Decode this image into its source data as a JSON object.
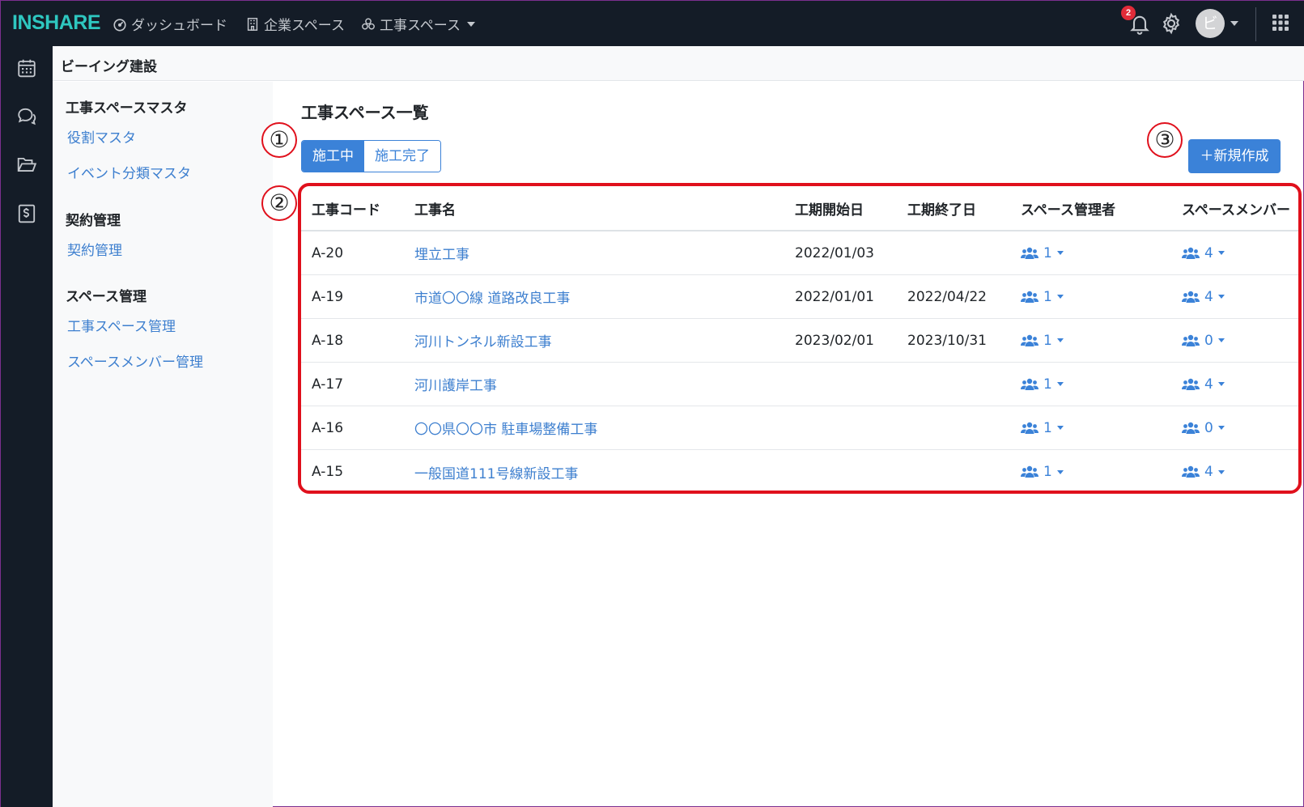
{
  "topbar": {
    "logo": "INSHARE",
    "nav": [
      {
        "label": "ダッシュボード",
        "icon": "dashboard-gauge-icon"
      },
      {
        "label": "企業スペース",
        "icon": "building-icon"
      },
      {
        "label": "工事スペース",
        "icon": "cubes-icon"
      }
    ],
    "notification_count": "2",
    "avatar_initial": "ビ"
  },
  "rail": {
    "icons": [
      "calendar-icon",
      "chat-icon",
      "folder-icon",
      "contract-icon"
    ]
  },
  "breadcrumb": {
    "company": "ビーイング建設"
  },
  "sidenav": {
    "sections": [
      {
        "title": "工事スペースマスタ",
        "links": [
          "役割マスタ",
          "イベント分類マスタ"
        ]
      },
      {
        "title": "契約管理",
        "links": [
          "契約管理"
        ]
      },
      {
        "title": "スペース管理",
        "links": [
          "工事スペース管理",
          "スペースメンバー管理"
        ]
      }
    ]
  },
  "main": {
    "title": "工事スペース一覧",
    "filters": [
      {
        "label": "施工中",
        "active": true
      },
      {
        "label": "施工完了",
        "active": false
      }
    ],
    "new_button": "＋新規作成",
    "callouts": [
      "①",
      "②",
      "③"
    ],
    "table": {
      "columns": [
        "工事コード",
        "工事名",
        "工期開始日",
        "工期終了日",
        "スペース管理者",
        "スペースメンバー"
      ],
      "rows": [
        {
          "code": "A-20",
          "name": "埋立工事",
          "start": "2022/01/03",
          "end": "",
          "managers": "1",
          "members": "4"
        },
        {
          "code": "A-19",
          "name": "市道〇〇線 道路改良工事",
          "start": "2022/01/01",
          "end": "2022/04/22",
          "managers": "1",
          "members": "4"
        },
        {
          "code": "A-18",
          "name": "河川トンネル新設工事",
          "start": "2023/02/01",
          "end": "2023/10/31",
          "managers": "1",
          "members": "0"
        },
        {
          "code": "A-17",
          "name": "河川護岸工事",
          "start": "",
          "end": "",
          "managers": "1",
          "members": "4"
        },
        {
          "code": "A-16",
          "name": "〇〇県〇〇市 駐車場整備工事",
          "start": "",
          "end": "",
          "managers": "1",
          "members": "0"
        },
        {
          "code": "A-15",
          "name": "一般国道111号線新設工事",
          "start": "",
          "end": "",
          "managers": "1",
          "members": "4"
        }
      ]
    }
  },
  "colors": {
    "accent": "#3b82d8",
    "navbar": "#141c27",
    "highlight": "#e0101c",
    "logo": "#2ec7c0"
  }
}
